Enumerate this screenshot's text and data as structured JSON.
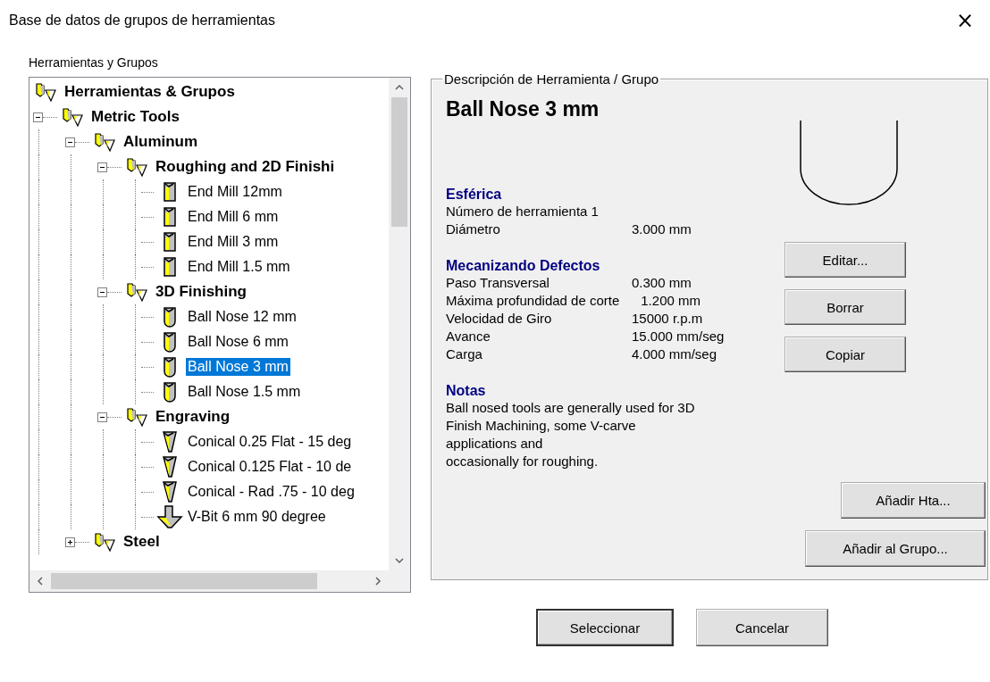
{
  "window": {
    "title": "Base de datos de grupos de herramientas",
    "close": "×"
  },
  "tree_label": "Herramientas y Grupos",
  "tree": {
    "items": [
      {
        "label": "Herramientas & Grupos",
        "kind": "group",
        "selected": false,
        "children": [
          {
            "label": "Metric Tools",
            "kind": "group",
            "expanded": true,
            "selected": false,
            "children": [
              {
                "label": "Aluminum",
                "kind": "group",
                "expanded": true,
                "selected": false,
                "children": [
                  {
                    "label": "Roughing and 2D Finishi",
                    "kind": "group",
                    "expanded": true,
                    "selected": false,
                    "children": [
                      {
                        "label": "End Mill 12mm",
                        "kind": "end-mill",
                        "selected": false
                      },
                      {
                        "label": "End Mill 6 mm",
                        "kind": "end-mill",
                        "selected": false
                      },
                      {
                        "label": "End Mill 3 mm",
                        "kind": "end-mill",
                        "selected": false
                      },
                      {
                        "label": "End Mill 1.5 mm",
                        "kind": "end-mill",
                        "selected": false
                      }
                    ]
                  },
                  {
                    "label": "3D Finishing",
                    "kind": "group",
                    "expanded": true,
                    "selected": false,
                    "children": [
                      {
                        "label": "Ball Nose 12 mm",
                        "kind": "ball-nose",
                        "selected": false
                      },
                      {
                        "label": "Ball Nose 6 mm",
                        "kind": "ball-nose",
                        "selected": false
                      },
                      {
                        "label": "Ball Nose 3 mm",
                        "kind": "ball-nose",
                        "selected": true
                      },
                      {
                        "label": "Ball Nose 1.5 mm",
                        "kind": "ball-nose",
                        "selected": false
                      }
                    ]
                  },
                  {
                    "label": "Engraving",
                    "kind": "group",
                    "expanded": true,
                    "selected": false,
                    "children": [
                      {
                        "label": "Conical 0.25 Flat - 15 deg",
                        "kind": "conical",
                        "selected": false
                      },
                      {
                        "label": "Conical 0.125 Flat - 10 de",
                        "kind": "conical",
                        "selected": false
                      },
                      {
                        "label": "Conical - Rad .75 - 10 deg",
                        "kind": "conical",
                        "selected": false
                      },
                      {
                        "label": "V-Bit 6 mm 90 degree",
                        "kind": "v-bit",
                        "selected": false
                      }
                    ]
                  }
                ]
              },
              {
                "label": "Steel",
                "kind": "group",
                "expanded": false,
                "selected": false
              }
            ]
          }
        ]
      }
    ]
  },
  "description": {
    "legend": "Descripción de Herramienta / Grupo",
    "title": "Ball Nose 3 mm",
    "sections": [
      {
        "heading": "Esférica",
        "rows": [
          {
            "label": "Número de herramienta 1"
          },
          {
            "label": "Diámetro",
            "value": "3.000 mm"
          }
        ]
      },
      {
        "heading": "Mecanizando Defectos",
        "rows": [
          {
            "label": "Paso Transversal",
            "value": "0.300 mm"
          },
          {
            "label": "Máxima profundidad de corte",
            "value": "1.200 mm"
          },
          {
            "label": "Velocidad de Giro",
            "value": "15000 r.p.m"
          },
          {
            "label": "Avance",
            "value": "15.000 mm/seg"
          },
          {
            "label": "Carga",
            "value": "4.000 mm/seg"
          }
        ]
      },
      {
        "heading": "Notas",
        "text": "Ball nosed tools are generally used for 3D\nFinish Machining, some V-carve\napplications and\noccasionally for roughing."
      }
    ],
    "actions": [
      "Editar...",
      "Borrar",
      "Copiar"
    ],
    "add_buttons": [
      "Añadir Hta...",
      "Añadir al Grupo..."
    ]
  },
  "buttons": [
    {
      "label": "Seleccionar",
      "default": true
    },
    {
      "label": "Cancelar",
      "default": false
    }
  ]
}
